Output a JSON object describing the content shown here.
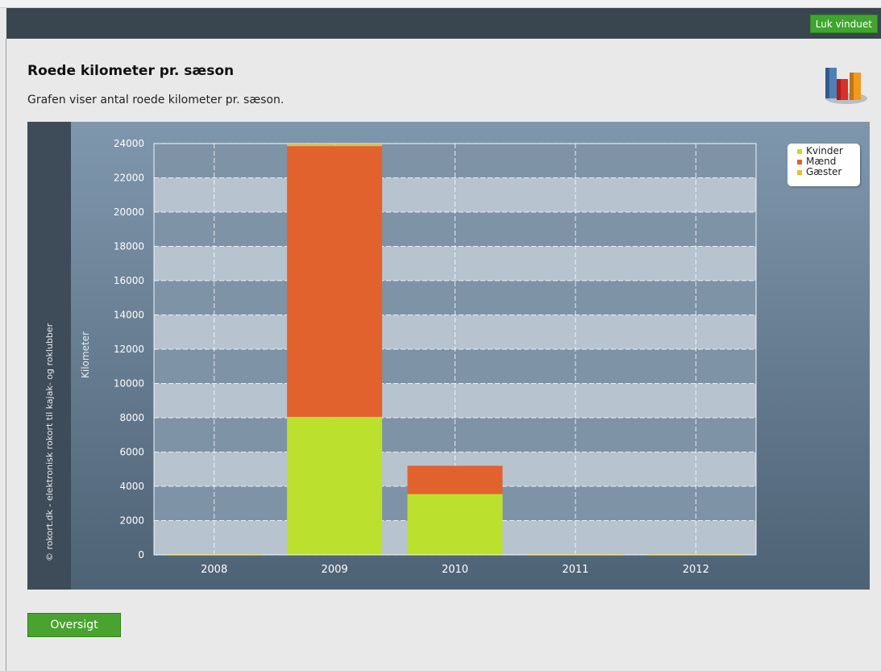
{
  "window": {
    "close_label": "Luk vinduet"
  },
  "page": {
    "title": "Roede kilometer pr. sæson",
    "subtitle": "Grafen viser antal roede kilometer pr. sæson.",
    "overview_label": "Oversigt"
  },
  "icons": {
    "header_chart": "bar-chart-icon"
  },
  "colors": {
    "Kvinder": "#bce02e",
    "Mænd": "#e2622d",
    "Gæster": "#e8c21e",
    "button_green": "#4aa32f",
    "titlebar": "#3a464f"
  },
  "chart_data": {
    "type": "bar",
    "stacked": true,
    "watermark": "© rokort.dk - elektronisk rokort til kajak- og roklubber",
    "ylabel": "Kilometer",
    "xlabel": "",
    "ylim": [
      0,
      24000
    ],
    "yticks": [
      0,
      2000,
      4000,
      6000,
      8000,
      10000,
      12000,
      14000,
      16000,
      18000,
      20000,
      22000,
      24000
    ],
    "categories": [
      "2008",
      "2009",
      "2010",
      "2011",
      "2012"
    ],
    "series": [
      {
        "name": "Kvinder",
        "values": [
          0,
          8050,
          3550,
          0,
          0
        ]
      },
      {
        "name": "Mænd",
        "values": [
          0,
          15800,
          1650,
          0,
          0
        ]
      },
      {
        "name": "Gæster",
        "values": [
          0,
          100,
          0,
          0,
          0
        ]
      }
    ],
    "legend_position": "top-right",
    "grid": true
  }
}
